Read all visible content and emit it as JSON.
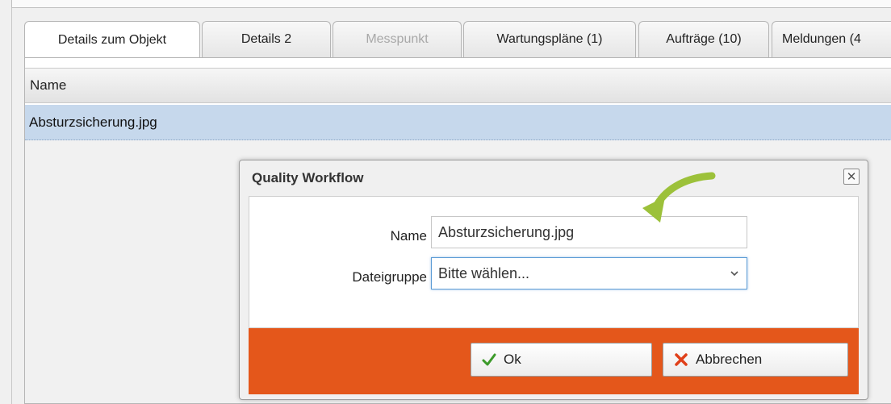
{
  "tabs": [
    {
      "label": "Details zum Objekt",
      "state": "active"
    },
    {
      "label": "Details 2",
      "state": "normal"
    },
    {
      "label": "Messpunkt",
      "state": "disabled"
    },
    {
      "label": "Wartungspläne (1)",
      "state": "normal"
    },
    {
      "label": "Aufträge (10)",
      "state": "normal"
    },
    {
      "label": "Meldungen (4",
      "state": "normal"
    }
  ],
  "grid": {
    "header": "Name",
    "rows": [
      {
        "name": "Absturzsicherung.jpg",
        "selected": true
      }
    ]
  },
  "dialog": {
    "title": "Quality Workflow",
    "close_icon": "close-icon",
    "fields": {
      "name_label": "Name",
      "name_value": "Absturzsicherung.jpg",
      "group_label": "Dateigruppe",
      "group_value": "Bitte wählen..."
    },
    "buttons": {
      "ok_label": "Ok",
      "cancel_label": "Abbrechen"
    }
  },
  "colors": {
    "button_bar": "#e4571b",
    "selected_row": "#c6d8ec",
    "ok_check": "#3c9a2a",
    "cancel_x": "#e0401a",
    "annotation_arrow": "#9cc13a"
  }
}
